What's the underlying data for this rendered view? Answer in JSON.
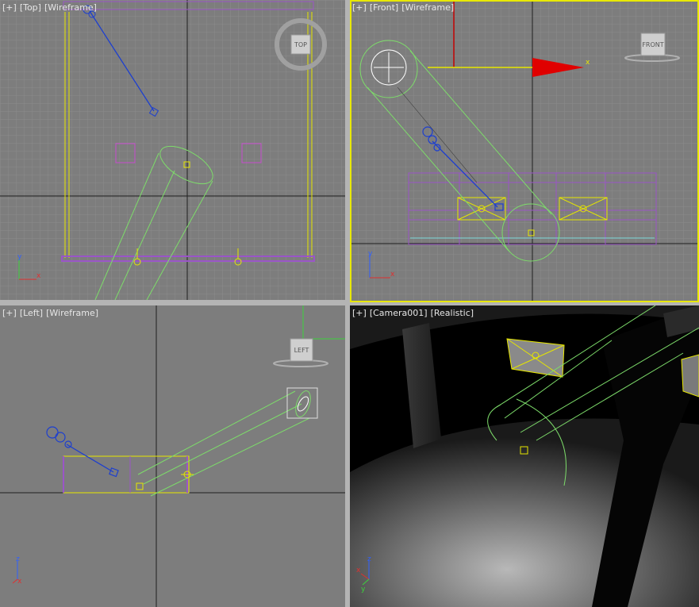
{
  "viewports": {
    "top": {
      "plus": "[+]",
      "view": "[Top]",
      "shading": "[Wireframe]",
      "cube_label": "TOP",
      "axis_x": "x",
      "axis_y": "y"
    },
    "front": {
      "plus": "[+]",
      "view": "[Front]",
      "shading": "[Wireframe]",
      "cube_label": "FRONT",
      "axis_x": "x",
      "axis_y": "y",
      "gizmo_x": "x"
    },
    "left": {
      "plus": "[+]",
      "view": "[Left]",
      "shading": "[Wireframe]",
      "cube_label": "LEFT",
      "axis_x": "x",
      "axis_y": "z"
    },
    "camera": {
      "plus": "[+]",
      "view": "[Camera001]",
      "shading": "[Realistic]",
      "axis_x": "x",
      "axis_y": "z",
      "axis_z": "y"
    }
  },
  "colors": {
    "viewport_bg": "#7d7d7d",
    "grid_line": "#8a8a8a",
    "active_border": "#e8e800",
    "cylinder": "#7ddc6a",
    "light": "#1d3fcf",
    "frame_yellow": "#e6e600",
    "frame_purple": "#9a55c8",
    "gizmo_red": "#e00000"
  },
  "icons": [
    "view-cube-icon",
    "axis-tripod-icon",
    "camera-icon",
    "spotlight-icon",
    "light-target-icon"
  ]
}
